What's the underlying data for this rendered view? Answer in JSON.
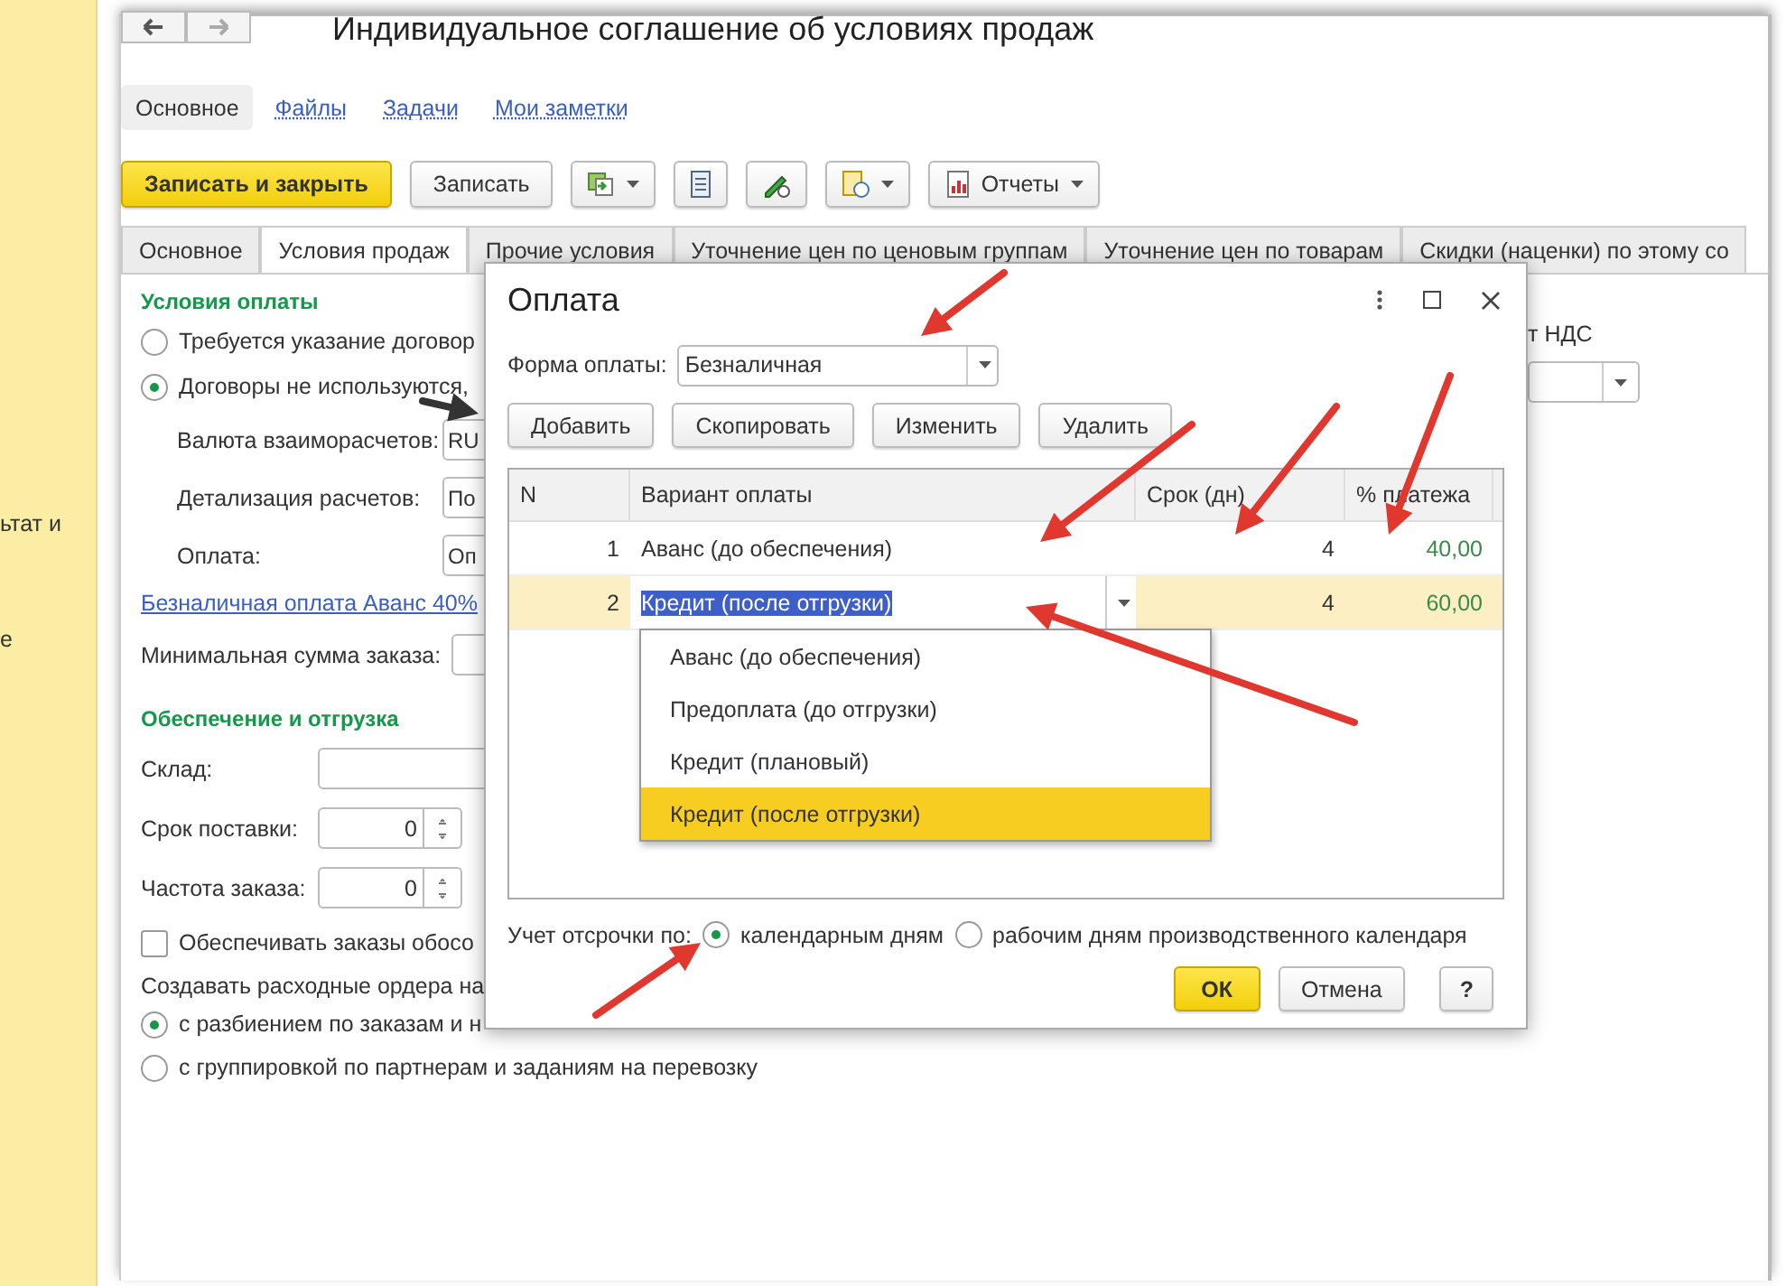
{
  "sidebar_fragments": [
    "ьтат и",
    "е"
  ],
  "window": {
    "title": "Индивидуальное соглашение об условиях продаж"
  },
  "sections": [
    {
      "label": "Основное",
      "selected": true
    },
    {
      "label": "Файлы",
      "selected": false
    },
    {
      "label": "Задачи",
      "selected": false
    },
    {
      "label": "Мои заметки",
      "selected": false
    }
  ],
  "toolbar": {
    "primary": "Записать и закрыть",
    "save": "Записать",
    "reports": "Отчеты"
  },
  "tabs": [
    {
      "label": "Основное",
      "selected": false
    },
    {
      "label": "Условия продаж",
      "selected": true
    },
    {
      "label": "Прочие условия",
      "selected": false
    },
    {
      "label": "Уточнение цен по ценовым группам",
      "selected": false
    },
    {
      "label": "Уточнение цен по товарам",
      "selected": false
    },
    {
      "label": "Скидки (наценки) по этому со",
      "selected": false
    }
  ],
  "payment_terms": {
    "heading": "Условия оплаты",
    "options": [
      {
        "label": "Требуется указание договор",
        "selected": false
      },
      {
        "label": "Договоры не используются,",
        "selected": true
      }
    ],
    "fields": [
      {
        "label": "Валюта взаиморасчетов:",
        "value": "RU"
      },
      {
        "label": "Детализация расчетов:",
        "value": "По"
      },
      {
        "label": "Оплата:",
        "value": "Оп"
      }
    ],
    "link": "Безналичная оплата Аванс 40%",
    "min_order_label": "Минимальная сумма заказа:"
  },
  "shipping": {
    "heading": "Обеспечение и отгрузка",
    "fields": [
      {
        "label": "Склад:",
        "kind": "text"
      },
      {
        "label": "Срок поставки:",
        "kind": "spin",
        "value": "0"
      },
      {
        "label": "Частота заказа:",
        "kind": "spin",
        "value": "0"
      }
    ],
    "checkbox": {
      "label": "Обеспечивать заказы обосо",
      "checked": false
    },
    "orders_label": "Создавать расходные ордера на",
    "order_options": [
      {
        "label": "с разбиением по заказам и н",
        "selected": true
      },
      {
        "label": "с группировкой по партнерам и заданиям на перевозку",
        "selected": false
      }
    ]
  },
  "right_fragment": "т НДС",
  "dialog": {
    "title": "Оплата",
    "form_label": "Форма оплаты:",
    "form_value": "Безналичная",
    "buttons": [
      "Добавить",
      "Скопировать",
      "Изменить",
      "Удалить"
    ],
    "columns": [
      "N",
      "Вариант оплаты",
      "Срок (дн)",
      "% платежа"
    ],
    "rows": [
      {
        "n": "1",
        "variant": "Аванс (до обеспечения)",
        "days": "4",
        "percent": "40,00",
        "selected": false
      },
      {
        "n": "2",
        "variant": "Кредит (после отгрузки)",
        "days": "4",
        "percent": "60,00",
        "selected": true
      }
    ],
    "dropdown": [
      {
        "label": "Аванс (до обеспечения)",
        "selected": false
      },
      {
        "label": "Предоплата (до отгрузки)",
        "selected": false
      },
      {
        "label": "Кредит (плановый)",
        "selected": false
      },
      {
        "label": "Кредит (после отгрузки)",
        "selected": true
      }
    ],
    "deferral_label": "Учет отсрочки по:",
    "deferral_options": [
      {
        "label": "календарным дням",
        "selected": true
      },
      {
        "label": "рабочим дням производственного календаря",
        "selected": false
      }
    ],
    "ok": "ОК",
    "cancel": "Отмена",
    "help": "?"
  }
}
